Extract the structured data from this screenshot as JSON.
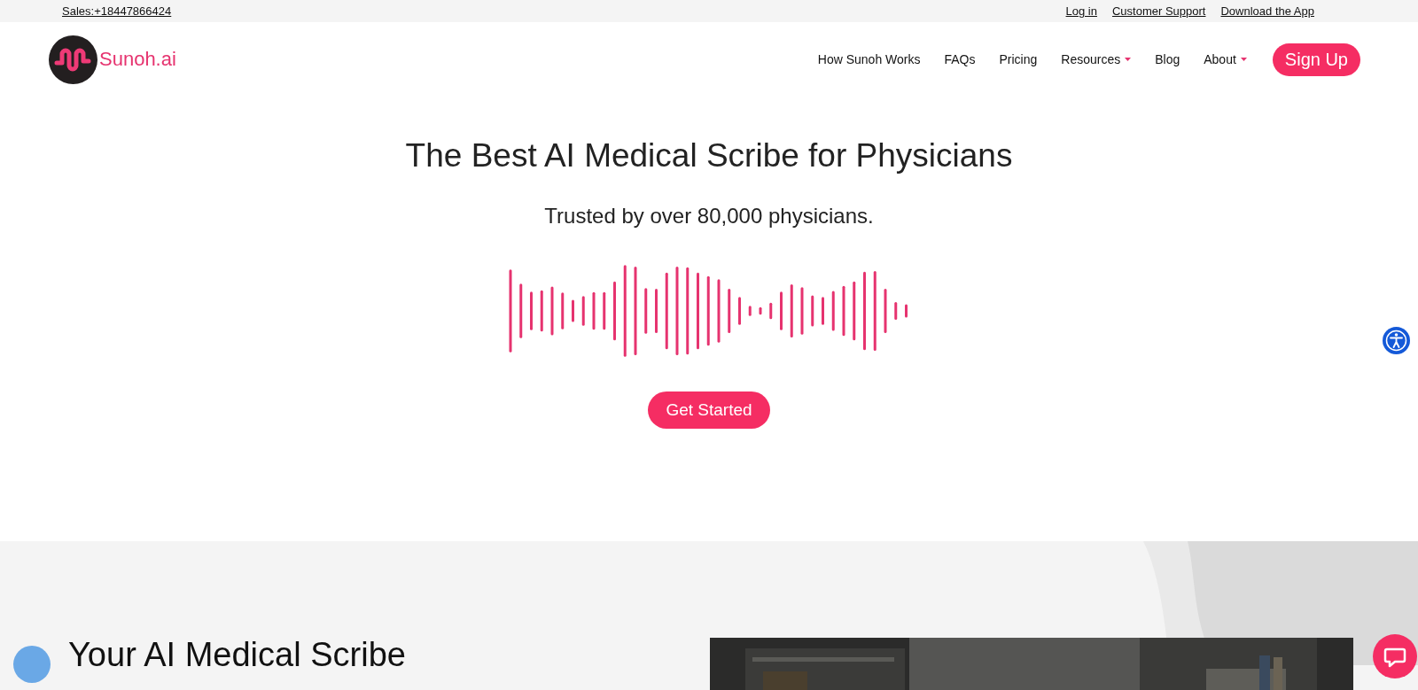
{
  "top_bar": {
    "sales": "Sales:+18447866424",
    "links": [
      "Log in",
      "Customer Support",
      "Download the App"
    ]
  },
  "header": {
    "logo_text": "Sunoh.ai",
    "nav": [
      {
        "label": "How Sunoh Works",
        "kind": "link"
      },
      {
        "label": "FAQs",
        "kind": "link"
      },
      {
        "label": "Pricing",
        "kind": "link"
      },
      {
        "label": "Resources",
        "kind": "dropdown"
      },
      {
        "label": "Blog",
        "kind": "link"
      },
      {
        "label": "About",
        "kind": "dropdown"
      }
    ],
    "signup": "Sign Up"
  },
  "hero": {
    "title": "The Best AI Medical Scribe for Physicians",
    "subtitle": "Trusted by over 80,000 physicians.",
    "cta": "Get Started"
  },
  "section": {
    "title": "Your AI Medical Scribe"
  }
}
